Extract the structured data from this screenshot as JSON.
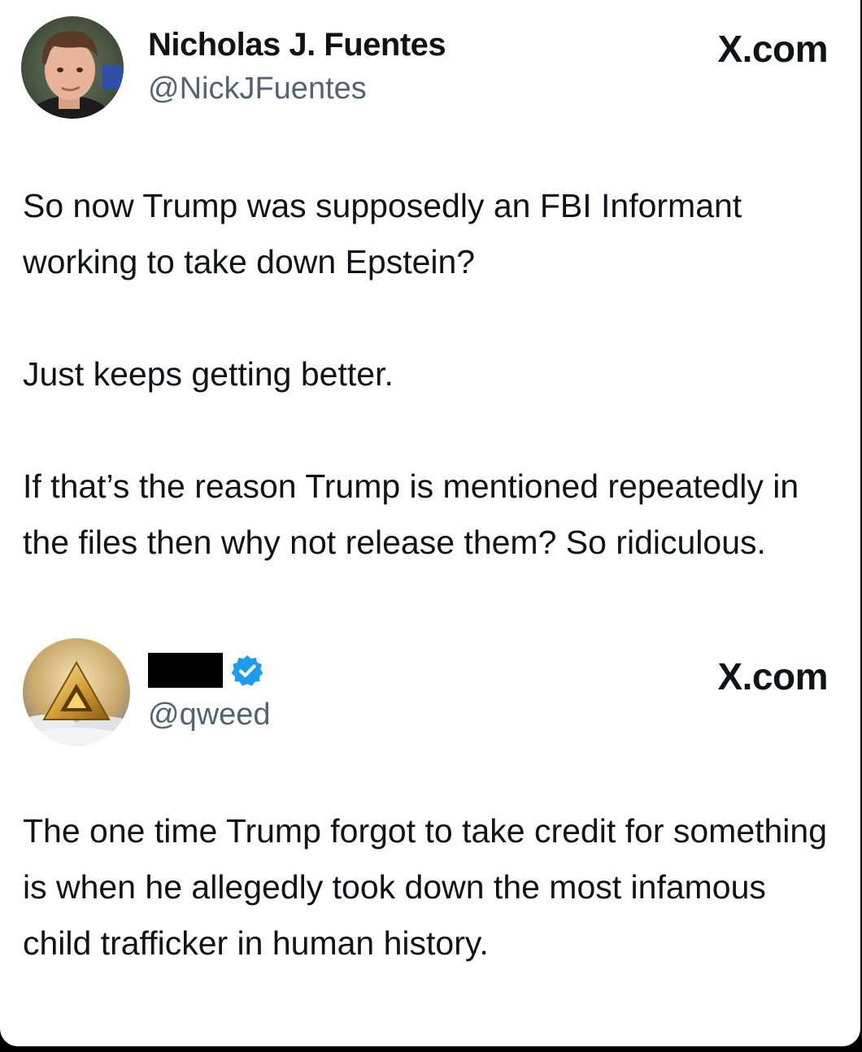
{
  "tweets": [
    {
      "display_name": "Nicholas J. Fuentes",
      "handle": "@NickJFuentes",
      "brand": "X.com",
      "paragraphs": [
        "So now Trump was supposedly an FBI Informant working to take down Epstein?",
        "Just keeps getting better.",
        "If that’s the reason Trump is mentioned repeatedly in the files then why not release them? So ridiculous."
      ]
    },
    {
      "display_name_redacted": true,
      "verified": true,
      "handle": "@qweed",
      "brand": "X.com",
      "paragraphs": [
        "The one time Trump forgot to take credit for something is when he allegedly took down the most infamous child trafficker in human history."
      ]
    }
  ],
  "icons": {
    "verified": "verified-badge-icon",
    "avatar_1": "profile-photo",
    "avatar_2": "golden-triangle-pyramid-avatar"
  },
  "colors": {
    "background": "#ffffff",
    "text": "#0f1419",
    "handle": "#536471",
    "verified_blue": "#1d9bf0",
    "outer": "#000000"
  }
}
